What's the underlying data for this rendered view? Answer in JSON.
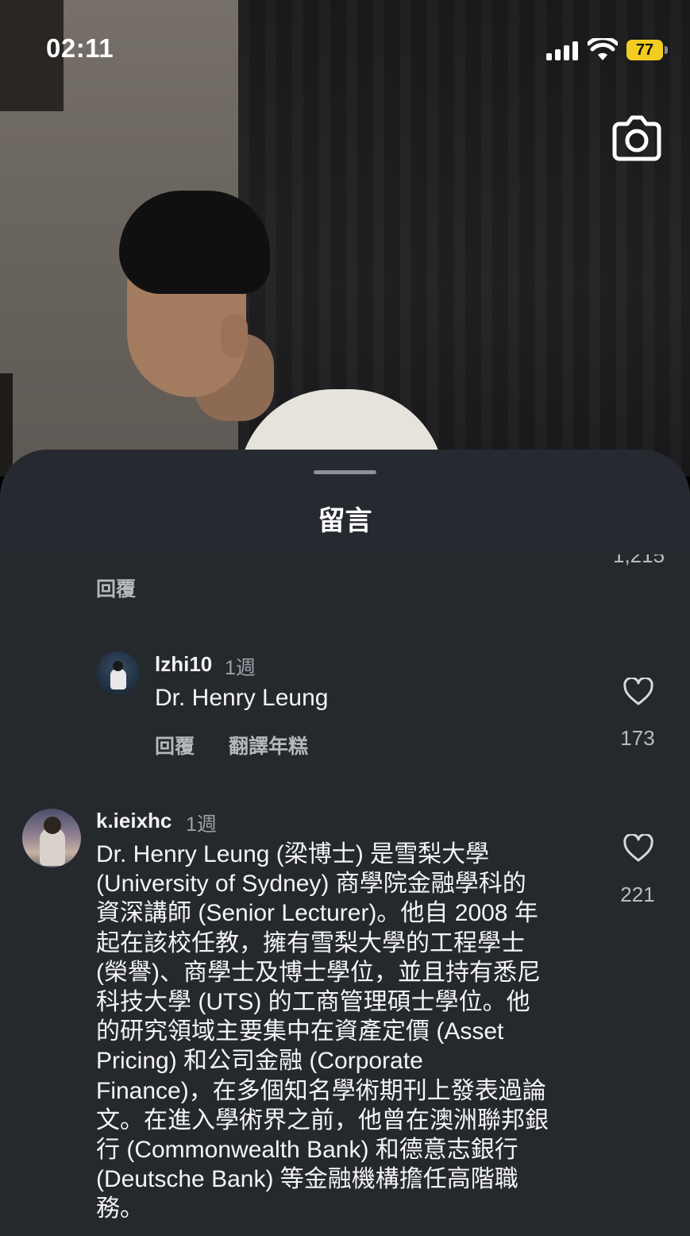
{
  "status_bar": {
    "time": "02:11",
    "battery": "77"
  },
  "icons": {
    "camera": "camera-icon",
    "signal": "cellular-signal-icon",
    "wifi": "wifi-icon",
    "heart": "heart-outline-icon"
  },
  "sheet": {
    "title": "留言"
  },
  "comments": {
    "partial": {
      "likes": "1,215",
      "reply_label": "回覆"
    },
    "reply_1": {
      "username": "lzhi10",
      "time": "1週",
      "text": "Dr. Henry Leung",
      "reply_label": "回覆",
      "translate_label": "翻譯年糕",
      "likes": "173"
    },
    "comment_2": {
      "username": "k.ieixhc",
      "time": "1週",
      "text": "Dr. Henry Leung (梁博士) 是雪梨大學\n(University of Sydney) 商學院金融學科的\n資深講師 (Senior Lecturer)。他自 2008 年\n起在該校任教，擁有雪梨大學的工程學士\n(榮譽)、商學士及博士學位，並且持有悉尼\n科技大學 (UTS) 的工商管理碩士學位。他\n的研究領域主要集中在資產定價 (Asset\nPricing) 和公司金融 (Corporate\nFinance)，在多個知名學術期刊上發表過論\n文。在進入學術界之前，他曾在澳洲聯邦銀\n行 (Commonwealth Bank) 和德意志銀行\n(Deutsche Bank) 等金融機構擔任高階職\n務。",
      "likes": "221"
    }
  },
  "colors": {
    "sheet_bg": "#262a30",
    "battery": "#f3cc22"
  }
}
